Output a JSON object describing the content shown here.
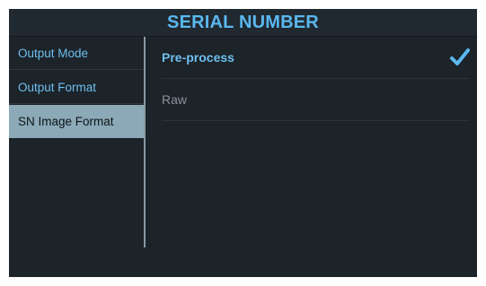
{
  "header": {
    "title": "SERIAL NUMBER"
  },
  "sidebar": {
    "items": [
      {
        "label": "Output Mode",
        "selected": false
      },
      {
        "label": "Output Format",
        "selected": false
      },
      {
        "label": "SN Image Format",
        "selected": true
      }
    ]
  },
  "options": {
    "items": [
      {
        "label": "Pre-process",
        "checked": true
      },
      {
        "label": "Raw",
        "checked": false
      }
    ],
    "check_icon": "checkmark-icon"
  },
  "colors": {
    "background": "#1c2329",
    "accent": "#5ab8ee",
    "selected_sidebar": "#8ba9b7",
    "inactive_text": "#8a939a"
  }
}
